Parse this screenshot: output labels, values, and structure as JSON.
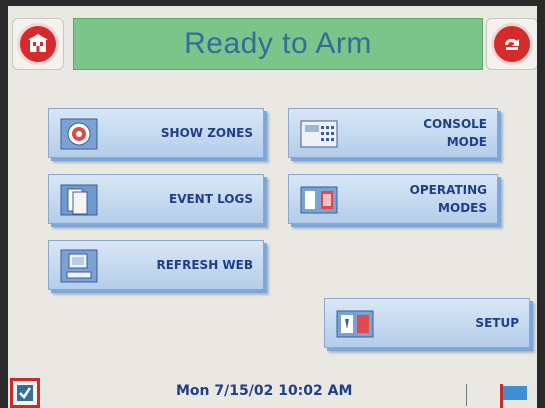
{
  "header": {
    "title": "Ready to Arm",
    "home_icon": "home-icon",
    "back_icon": "back-icon"
  },
  "menu": {
    "show_zones": {
      "label": "SHOW ZONES",
      "icon": "target-icon"
    },
    "console_mode": {
      "label": "CONSOLE\nMODE",
      "icon": "keypad-icon"
    },
    "event_logs": {
      "label": "EVENT LOGS",
      "icon": "log-pages-icon"
    },
    "operating_modes": {
      "label": "OPERATING\nMODES",
      "icon": "mode-switch-icon"
    },
    "refresh_web": {
      "label": "REFRESH WEB",
      "icon": "computer-icon"
    },
    "setup": {
      "label": "SETUP",
      "icon": "setup-icon"
    }
  },
  "status": {
    "datetime": "Mon 7/15/02 10:02 AM",
    "left_icon": "checkbox-icon",
    "right_icon": "flag-icon"
  },
  "colors": {
    "title_bar": "#7cc48a",
    "title_text": "#2f6f9a",
    "button_face": "#c6daf0",
    "label_text": "#1f3f8a",
    "alert_red": "#d62b2b"
  }
}
